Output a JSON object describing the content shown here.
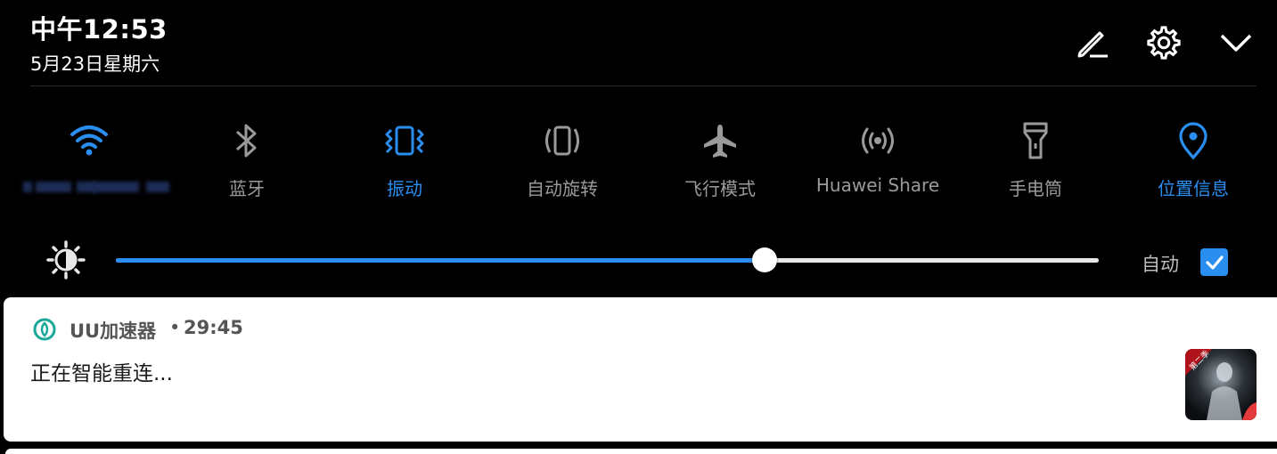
{
  "status": {
    "time": "中午12:53",
    "date": "5月23日星期六"
  },
  "header_icons": [
    "edit-icon",
    "settings-gear-icon",
    "chevron-down-icon"
  ],
  "tiles": [
    {
      "id": "wifi",
      "icon": "wifi-icon",
      "label": "",
      "active": true
    },
    {
      "id": "bluetooth",
      "icon": "bluetooth-icon",
      "label": "蓝牙",
      "active": false
    },
    {
      "id": "vibrate",
      "icon": "vibrate-icon",
      "label": "振动",
      "active": true
    },
    {
      "id": "autorotate",
      "icon": "auto-rotate-icon",
      "label": "自动旋转",
      "active": false
    },
    {
      "id": "airplane",
      "icon": "airplane-icon",
      "label": "飞行模式",
      "active": false
    },
    {
      "id": "huawei-share",
      "icon": "huawei-share-icon",
      "label": "Huawei Share",
      "active": false
    },
    {
      "id": "flashlight",
      "icon": "flashlight-icon",
      "label": "手电筒",
      "active": false
    },
    {
      "id": "location",
      "icon": "location-pin-icon",
      "label": "位置信息",
      "active": true
    }
  ],
  "brightness": {
    "level": 0.66,
    "auto_label": "自动",
    "auto_checked": true
  },
  "notification": {
    "app": "UU加速器",
    "separator": "•",
    "time": "29:45",
    "text": "正在智能重连...",
    "thumb_badge": "第二季"
  },
  "colors": {
    "accent": "#2a8ef0",
    "inactive": "#9a9a9a",
    "background": "#000000"
  }
}
